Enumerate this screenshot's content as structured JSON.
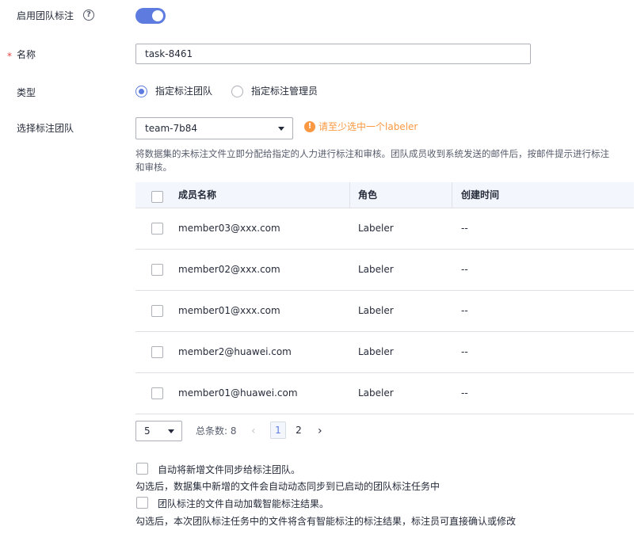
{
  "form": {
    "team_label_toggle": {
      "label": "启用团队标注",
      "enabled": true
    },
    "name": {
      "label": "名称",
      "required_mark": "*",
      "value": "task-8461"
    },
    "type": {
      "label": "类型",
      "options": [
        {
          "label": "指定标注团队",
          "checked": true
        },
        {
          "label": "指定标注管理员",
          "checked": false
        }
      ]
    },
    "team_select": {
      "label": "选择标注团队",
      "value": "team-7b84",
      "warning": "请至少选中一个labeler",
      "description": "将数据集的未标注文件立即分配给指定的人力进行标注和审核。团队成员收到系统发送的邮件后，按邮件提示进行标注和审核。"
    }
  },
  "table": {
    "columns": [
      "成员名称",
      "角色",
      "创建时间"
    ],
    "rows": [
      {
        "member": "member03@xxx.com",
        "role": "Labeler",
        "created": "--"
      },
      {
        "member": "member02@xxx.com",
        "role": "Labeler",
        "created": "--"
      },
      {
        "member": "member01@xxx.com",
        "role": "Labeler",
        "created": "--"
      },
      {
        "member": "member2@huawei.com",
        "role": "Labeler",
        "created": "--"
      },
      {
        "member": "member01@huawei.com",
        "role": "Labeler",
        "created": "--"
      }
    ]
  },
  "pagination": {
    "page_size": "5",
    "total_text": "总条数: 8",
    "pages": [
      "1",
      "2"
    ],
    "current_page": "1"
  },
  "options": {
    "sync_new_files": {
      "label": "自动将新增文件同步给标注团队。",
      "hint": "勾选后，数据集中新增的文件会自动动态同步到已启动的团队标注任务中",
      "checked": false
    },
    "auto_load_smart": {
      "label": "团队标注的文件自动加载智能标注结果。",
      "hint": "勾选后，本次团队标注任务中的文件将含有智能标注的标注结果，标注员可直接确认或修改",
      "checked": false
    }
  },
  "icons": {
    "help": "question-circle-icon",
    "warning": "exclamation-circle-icon",
    "caret": "caret-down-icon",
    "prev": "chevron-left-icon",
    "next": "chevron-right-icon"
  },
  "colors": {
    "primary": "#5e7ce0",
    "warning": "#fa9841",
    "required": "#e54545",
    "header_bg": "#f3f6fc",
    "border": "#dfe1e6"
  }
}
